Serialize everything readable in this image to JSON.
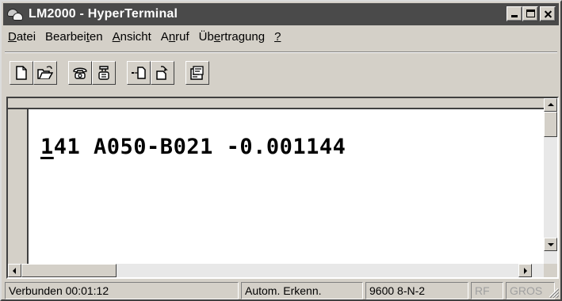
{
  "window": {
    "title": "LM2000 - HyperTerminal"
  },
  "menu": {
    "items": [
      {
        "pre": "",
        "accel": "D",
        "post": "atei"
      },
      {
        "pre": "Bearbei",
        "accel": "t",
        "post": "en"
      },
      {
        "pre": "",
        "accel": "A",
        "post": "nsicht"
      },
      {
        "pre": "A",
        "accel": "n",
        "post": "ruf"
      },
      {
        "pre": "Üb",
        "accel": "e",
        "post": "rtragung"
      },
      {
        "pre": "",
        "accel": "?",
        "post": ""
      }
    ]
  },
  "toolbar": {
    "buttons": [
      "new-file-icon",
      "open-folder-icon",
      "connect-phone-icon",
      "disconnect-phone-icon",
      "send-file-icon",
      "receive-file-icon",
      "properties-icon"
    ]
  },
  "terminal": {
    "cursor_char": "1",
    "line_rest": "41 A050-B021 -0.001144"
  },
  "status": {
    "connected": "Verbunden 00:01:12",
    "detect": "Autom. Erkenn.",
    "settings": "9600 8-N-2",
    "scroll": "RF",
    "caps": "GROS"
  },
  "colors": {
    "titlebar": "#4a4a4a",
    "face": "#d4d0c8",
    "terminal_bg": "#ffffff"
  }
}
